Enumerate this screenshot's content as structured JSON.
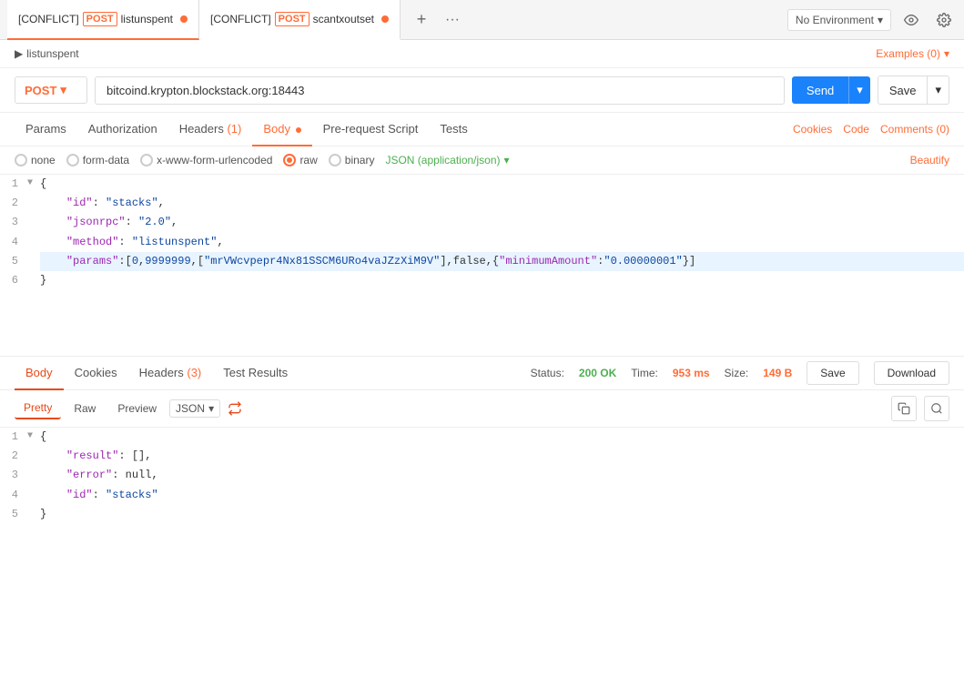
{
  "tabs": [
    {
      "label": "listunspent",
      "method": "POST",
      "conflict": true,
      "active": true
    },
    {
      "label": "scantxoutset",
      "method": "POST",
      "conflict": true,
      "active": false
    }
  ],
  "env": {
    "selected": "No Environment",
    "chevron": "▾"
  },
  "breadcrumb": "listunspent",
  "examples_label": "Examples (0)",
  "request": {
    "method": "POST",
    "url": "bitcoind.krypton.blockstack.org:18443",
    "send_label": "Send",
    "save_label": "Save"
  },
  "req_tabs": [
    {
      "label": "Params",
      "active": false
    },
    {
      "label": "Authorization",
      "active": false
    },
    {
      "label": "Headers",
      "badge": "(1)",
      "active": false
    },
    {
      "label": "Body",
      "dot": true,
      "active": true
    },
    {
      "label": "Pre-request Script",
      "active": false
    },
    {
      "label": "Tests",
      "active": false
    }
  ],
  "right_tabs": [
    {
      "label": "Cookies"
    },
    {
      "label": "Code"
    },
    {
      "label": "Comments (0)"
    }
  ],
  "body_options": [
    {
      "label": "none",
      "selected": false
    },
    {
      "label": "form-data",
      "selected": false
    },
    {
      "label": "x-www-form-urlencoded",
      "selected": false
    },
    {
      "label": "raw",
      "selected": true
    },
    {
      "label": "binary",
      "selected": false
    }
  ],
  "json_type": "JSON (application/json)",
  "beautify_label": "Beautify",
  "code_lines": [
    {
      "num": "1",
      "toggle": "▼",
      "content": "{",
      "highlight": false
    },
    {
      "num": "2",
      "toggle": "",
      "content": "    \"id\": \"stacks\",",
      "highlight": false
    },
    {
      "num": "3",
      "toggle": "",
      "content": "    \"jsonrpc\": \"2.0\",",
      "highlight": false
    },
    {
      "num": "4",
      "toggle": "",
      "content": "    \"method\": \"listunspent\",",
      "highlight": false
    },
    {
      "num": "5",
      "toggle": "",
      "content": "    \"params\":[0,9999999,[\"mrVWcvpepr4Nx81SSCM6URo4vaJZzXiM9V\"],false,{\"minimumAmount\":\"0.00000001\"}]",
      "highlight": true
    },
    {
      "num": "6",
      "toggle": "",
      "content": "}",
      "highlight": false
    }
  ],
  "response": {
    "tabs": [
      {
        "label": "Body",
        "active": true
      },
      {
        "label": "Cookies",
        "active": false
      },
      {
        "label": "Headers",
        "badge": "(3)",
        "active": false
      },
      {
        "label": "Test Results",
        "active": false
      }
    ],
    "status_label": "Status:",
    "status_value": "200 OK",
    "time_label": "Time:",
    "time_value": "953 ms",
    "size_label": "Size:",
    "size_value": "149 B",
    "save_label": "Save",
    "download_label": "Download",
    "format_tabs": [
      "Pretty",
      "Raw",
      "Preview"
    ],
    "active_format": "Pretty",
    "json_select": "JSON",
    "resp_lines": [
      {
        "num": "1",
        "toggle": "▼",
        "content": "{",
        "highlight": false
      },
      {
        "num": "2",
        "toggle": "",
        "content": "    \"result\": [],",
        "highlight": false
      },
      {
        "num": "3",
        "toggle": "",
        "content": "    \"error\": null,",
        "highlight": false
      },
      {
        "num": "4",
        "toggle": "",
        "content": "    \"id\": \"stacks\"",
        "highlight": false
      },
      {
        "num": "5",
        "toggle": "",
        "content": "}",
        "highlight": false
      }
    ]
  }
}
